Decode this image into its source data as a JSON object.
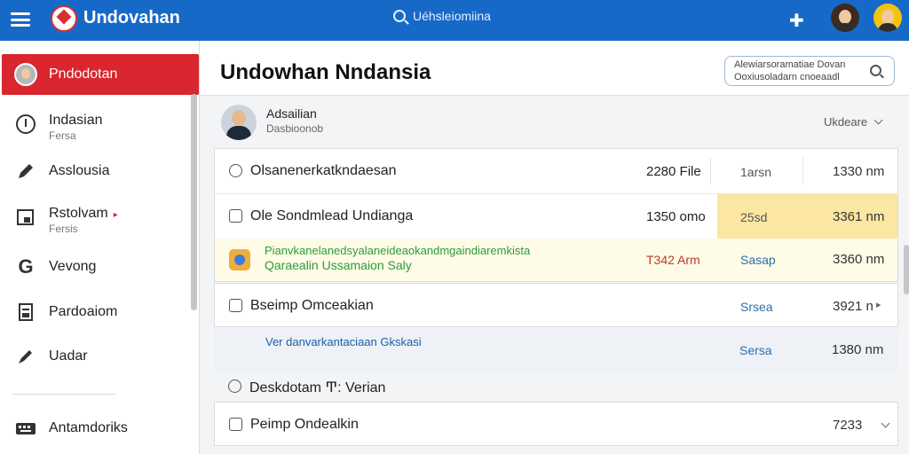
{
  "topbar": {
    "brand": "Undovahan",
    "search_text": "Uéhsleiomiina"
  },
  "sidebar": {
    "items": [
      {
        "label": "Pndodotan",
        "sub": "",
        "icon": "avatar"
      },
      {
        "label": "Indasian",
        "sub": "Fersa",
        "icon": "info-circle-icon"
      },
      {
        "label": "Asslousia",
        "sub": "",
        "icon": "pencil-icon"
      },
      {
        "label": "Rstolvam",
        "sub": "Fersis",
        "icon": "image-icon"
      },
      {
        "label": "Vevong",
        "sub": "",
        "icon": "g-icon"
      },
      {
        "label": "Pardoaiom",
        "sub": "",
        "icon": "document-icon"
      },
      {
        "label": "Uadar",
        "sub": "",
        "icon": "pen-icon"
      },
      {
        "label": "Antamdoriks",
        "sub": "",
        "icon": "keyboard-icon"
      }
    ]
  },
  "main": {
    "title": "Undowhan Nndansia",
    "search": {
      "line1": "Alewiarsoramatiae Dovan",
      "line2": "Ooxiusoladarn cnoeaadl"
    },
    "user": {
      "name": "Adsailian",
      "sub": "Dasbioonob"
    },
    "sort_label": "Ukdeare",
    "rows": [
      {
        "label": "Olsanenerkatkndaesan",
        "c1": "2280 File",
        "c2": "1arsn",
        "c3": "1330 nm"
      },
      {
        "label": "Ole Sondmlead Undianga",
        "c1": "1350 omo",
        "c2": "25sd",
        "c3": "3361 nm"
      },
      {
        "label": "Bseimp Omceakian",
        "c1": "",
        "c2": "Srsea",
        "c3": "3921 n"
      },
      {
        "label": "Peimp Ondealkin",
        "c1": "",
        "c2": "",
        "c3": "7233"
      }
    ],
    "highlight": {
      "line1": "Pianvkanelanedsyalaneideaokandmgaindiaremkista",
      "line2": "Qaraealin Ussamaion Saly",
      "time": "T342 Arm",
      "status": "Sasap",
      "size": "3360 nm"
    },
    "info_row": {
      "link": "Ver danvarkantaciaan Gkskasi",
      "status": "Sersa",
      "size": "1380 nm"
    },
    "desk_row": {
      "label": "Deskdotam Ͳ: Verian"
    }
  }
}
